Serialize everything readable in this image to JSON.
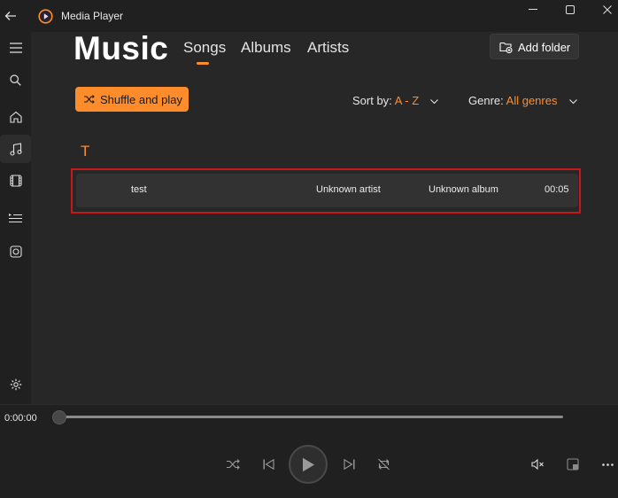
{
  "titlebar": {
    "app_title": "Media Player",
    "back_icon": "back-arrow-icon",
    "minimize_icon": "minimize-icon",
    "maximize_icon": "maximize-icon",
    "close_icon": "close-icon"
  },
  "rail": {
    "items": [
      {
        "icon": "hamburger-menu-icon"
      },
      {
        "icon": "search-icon"
      },
      {
        "icon": "home-icon"
      },
      {
        "icon": "music-note-icon",
        "active": true
      },
      {
        "icon": "film-icon"
      },
      {
        "icon": "playlist-icon"
      },
      {
        "icon": "play-queue-icon"
      },
      {
        "icon": "settings-icon"
      }
    ]
  },
  "header": {
    "title": "Music",
    "tabs": [
      {
        "label": "Songs",
        "selected": true
      },
      {
        "label": "Albums"
      },
      {
        "label": "Artists"
      }
    ],
    "add_folder_label": "Add folder"
  },
  "toolbar": {
    "shuffle_label": "Shuffle and play",
    "sort_label": "Sort by:",
    "sort_value": "A - Z",
    "genre_label": "Genre:",
    "genre_value": "All genres"
  },
  "songs": {
    "group_letter": "T",
    "rows": [
      {
        "title": "test",
        "artist": "Unknown artist",
        "album": "Unknown album",
        "duration": "00:05"
      }
    ]
  },
  "player": {
    "current_time": "0:00:00",
    "progress": 0
  },
  "colors": {
    "accent": "#ff8c2a",
    "background": "#202020",
    "content_background": "#272727",
    "highlight_outline": "#c8161d"
  }
}
